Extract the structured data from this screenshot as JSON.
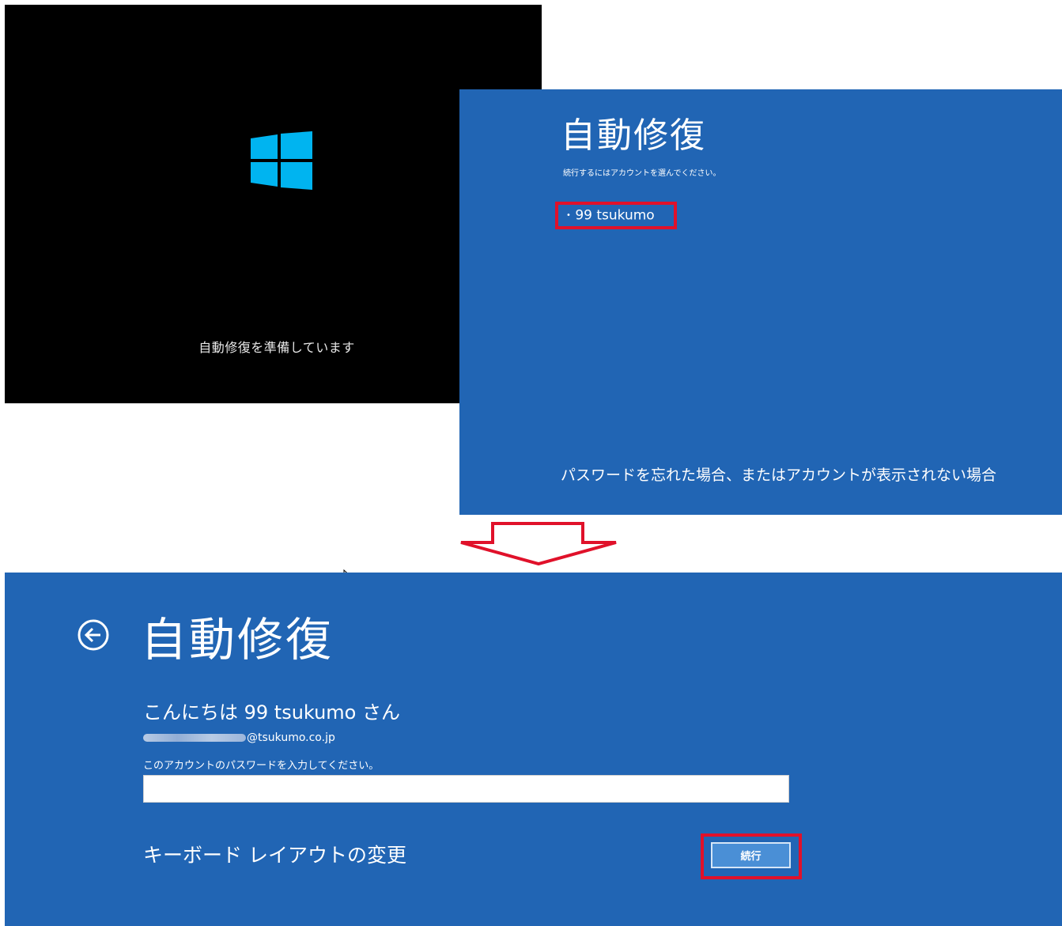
{
  "screen1": {
    "status_text": "自動修復を準備しています",
    "logo_color": "#00b4f0"
  },
  "screen2": {
    "title": "自動修復",
    "instruction": "続行するにはアカウントを選んでください。",
    "account": "99 tsukumo",
    "forgot_link": "パスワードを忘れた場合、またはアカウントが表示されない場合"
  },
  "screen3": {
    "title": "自動修復",
    "greeting": "こんにちは 99 tsukumo さん",
    "email_domain": "@tsukumo.co.jp",
    "password_label": "このアカウントのパスワードを入力してください。",
    "password_value": "",
    "keyboard_link": "キーボード レイアウトの変更",
    "continue_label": "続行"
  },
  "icons": {
    "logo": "windows-logo-icon",
    "back": "back-arrow-icon",
    "arrow": "down-arrow-icon",
    "cursor": "mouse-cursor-icon"
  },
  "colors": {
    "background_blue": "#2165b4",
    "highlight_red": "#e0112a",
    "button_blue": "#4a8fd6"
  }
}
